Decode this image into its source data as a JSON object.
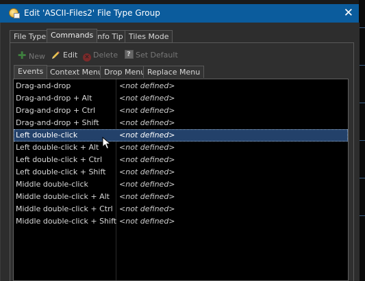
{
  "window": {
    "title": "Edit 'ASCII-Files2' File Type Group",
    "close_label": "✕"
  },
  "tabs": [
    {
      "label": "File Type",
      "active": false
    },
    {
      "label": "Commands",
      "active": true
    },
    {
      "label": "Info Tip",
      "active": false
    },
    {
      "label": "Tiles Mode",
      "active": false
    }
  ],
  "toolbar": {
    "new_label": "New",
    "edit_label": "Edit",
    "delete_label": "Delete",
    "set_default_label": "Set Default"
  },
  "subtabs": [
    {
      "label": "Events",
      "active": true
    },
    {
      "label": "Context Menu",
      "active": false
    },
    {
      "label": "Drop Menu",
      "active": false
    },
    {
      "label": "Replace Menu",
      "active": false
    }
  ],
  "events": [
    {
      "name": "Drag-and-drop",
      "command": "<not defined>"
    },
    {
      "name": "Drag-and-drop + Alt",
      "command": "<not defined>"
    },
    {
      "name": "Drag-and-drop + Ctrl",
      "command": "<not defined>"
    },
    {
      "name": "Drag-and-drop + Shift",
      "command": "<not defined>"
    },
    {
      "name": "Left double-click",
      "command": "<not defined>",
      "selected": true
    },
    {
      "name": "Left double-click + Alt",
      "command": "<not defined>"
    },
    {
      "name": "Left double-click + Ctrl",
      "command": "<not defined>"
    },
    {
      "name": "Left double-click + Shift",
      "command": "<not defined>"
    },
    {
      "name": "Middle double-click",
      "command": "<not defined>"
    },
    {
      "name": "Middle double-click + Alt",
      "command": "<not defined>"
    },
    {
      "name": "Middle double-click + Ctrl",
      "command": "<not defined>"
    },
    {
      "name": "Middle double-click + Shift",
      "command": "<not defined>"
    }
  ],
  "colors": {
    "titlebar": "#0b5c9d",
    "selection": "#23416a",
    "list_background": "#000000"
  }
}
